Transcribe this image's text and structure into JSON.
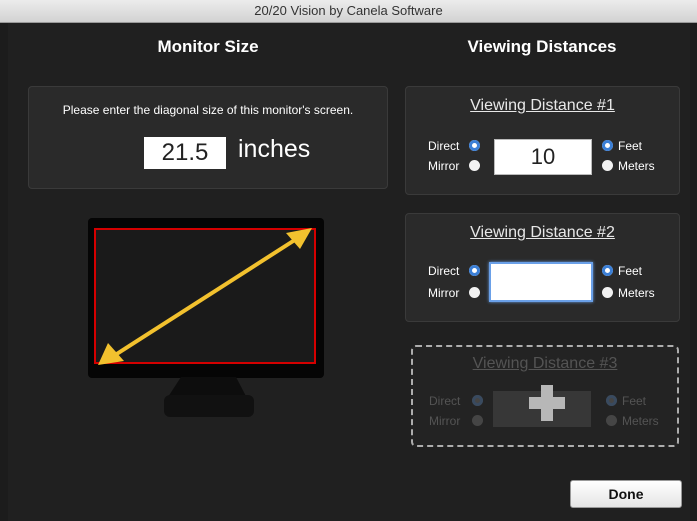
{
  "window": {
    "title": "20/20 Vision by Canela Software"
  },
  "monitor_size": {
    "heading": "Monitor Size",
    "instruction": "Please enter the diagonal size of this monitor's screen.",
    "value": "21.5",
    "unit": "inches"
  },
  "viewing_distances": {
    "heading": "Viewing Distances",
    "panels": [
      {
        "title": "Viewing Distance #1",
        "direct_label": "Direct",
        "mirror_label": "Mirror",
        "value": "10",
        "feet_label": "Feet",
        "meters_label": "Meters",
        "selected_mode": "Direct",
        "selected_unit": "Feet"
      },
      {
        "title": "Viewing Distance #2",
        "direct_label": "Direct",
        "mirror_label": "Mirror",
        "value": "",
        "feet_label": "Feet",
        "meters_label": "Meters",
        "selected_mode": "Direct",
        "selected_unit": "Feet"
      },
      {
        "title": "Viewing Distance #3",
        "direct_label": "Direct",
        "mirror_label": "Mirror",
        "feet_label": "Feet",
        "meters_label": "Meters",
        "state": "disabled"
      }
    ]
  },
  "buttons": {
    "done": "Done"
  },
  "colors": {
    "accent": "#3b7fd6",
    "arrow": "#f2c12e",
    "screen_border": "#d40000"
  },
  "icons": {
    "add_panel": "plus-icon"
  }
}
